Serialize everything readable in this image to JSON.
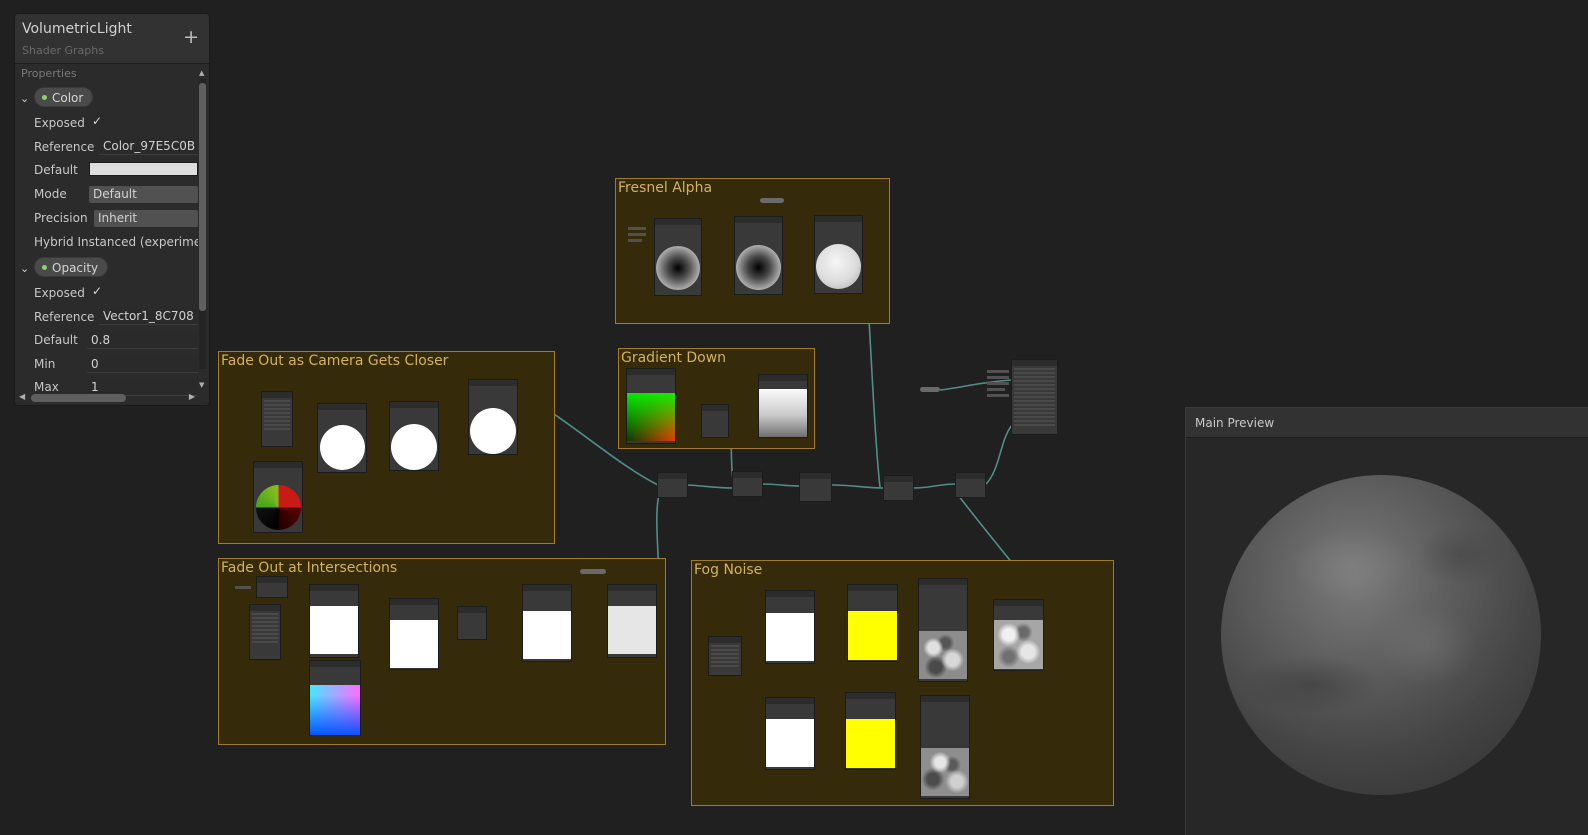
{
  "blackboard": {
    "title": "VolumetricLight",
    "subtitle": "Shader Graphs",
    "add_icon": "plus-icon",
    "section_label": "Properties",
    "properties": [
      {
        "name": "Color",
        "expanded": true,
        "fields": {
          "exposed_label": "Exposed",
          "exposed_check": "✓",
          "reference_label": "Reference",
          "reference_value": "Color_97E5C0B",
          "default_label": "Default",
          "default_color": "#dedede",
          "mode_label": "Mode",
          "mode_value": "Default",
          "precision_label": "Precision",
          "precision_value": "Inherit",
          "hybrid_label": "Hybrid Instanced (experimental)"
        }
      },
      {
        "name": "Opacity",
        "expanded": true,
        "fields": {
          "exposed_label": "Exposed",
          "exposed_check": "✓",
          "reference_label": "Reference",
          "reference_value": "Vector1_8C708",
          "default_label": "Default",
          "default_value": "0.8",
          "min_label": "Min",
          "min_value": "0",
          "max_label": "Max",
          "max_value": "1"
        }
      }
    ]
  },
  "groups": {
    "fresnel": "Fresnel Alpha",
    "gradient": "Gradient Down",
    "camera": "Fade Out as Camera Gets Closer",
    "intersections": "Fade Out at Intersections",
    "fog": "Fog Noise"
  },
  "main_preview": {
    "title": "Main Preview"
  },
  "colors": {
    "group_fill": "#352a09",
    "group_border": "#a07d25",
    "group_title": "#d5b25c",
    "wire": "#4f8f87",
    "accent_yellow": "#ffff00"
  }
}
